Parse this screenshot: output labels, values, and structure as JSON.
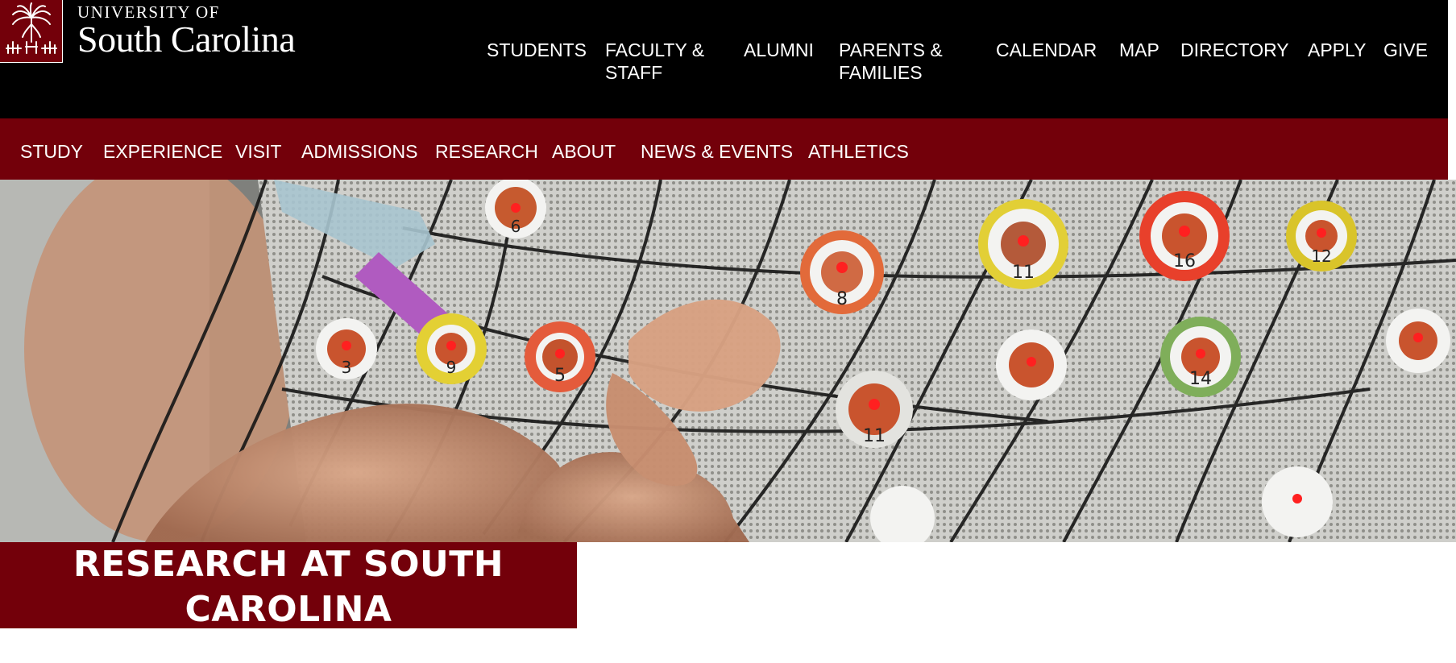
{
  "brand": {
    "line1": "UNIVERSITY OF",
    "line2": "South Carolina",
    "garnet": "#73000a",
    "black": "#000000"
  },
  "utility_nav": [
    {
      "label": "STUDENTS"
    },
    {
      "label": "FACULTY & STAFF"
    },
    {
      "label": "ALUMNI"
    },
    {
      "label": "PARENTS & FAMILIES"
    },
    {
      "label": "CALENDAR"
    },
    {
      "label": "MAP"
    },
    {
      "label": "DIRECTORY"
    },
    {
      "label": "APPLY"
    },
    {
      "label": "GIVE"
    }
  ],
  "main_nav": [
    {
      "label": "STUDY"
    },
    {
      "label": "EXPERIENCE"
    },
    {
      "label": "VISIT"
    },
    {
      "label": "ADMISSIONS"
    },
    {
      "label": "RESEARCH"
    },
    {
      "label": "ABOUT"
    },
    {
      "label": "NEWS & EVENTS"
    },
    {
      "label": "ATHLETICS"
    }
  ],
  "hero": {
    "icon": "eeg-cap-photo",
    "electrode_labels": [
      "6",
      "5",
      "8",
      "11",
      "16",
      "12",
      "14",
      "11",
      "3",
      "9"
    ]
  },
  "page": {
    "title": "RESEARCH AT SOUTH CAROLINA"
  }
}
